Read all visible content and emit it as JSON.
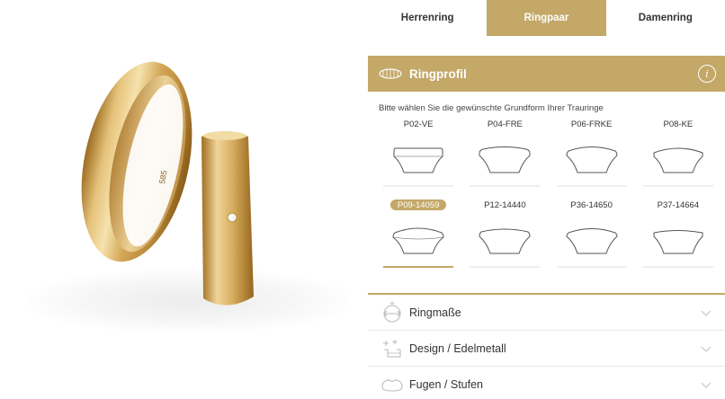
{
  "tabs": [
    {
      "label": "Herrenring",
      "active": false
    },
    {
      "label": "Ringpaar",
      "active": true
    },
    {
      "label": "Damenring",
      "active": false
    }
  ],
  "section": {
    "title": "Ringprofil",
    "info_icon": "info-icon",
    "instruction": "Bitte wählen Sie die gewünschte Grundform Ihrer Trauringe"
  },
  "profiles": [
    {
      "code": "P02-VE"
    },
    {
      "code": "P04-FRE"
    },
    {
      "code": "P06-FRKE"
    },
    {
      "code": "P08-KE"
    },
    {
      "code": "P09-14059",
      "selected": true
    },
    {
      "code": "P12-14440"
    },
    {
      "code": "P36-14650"
    },
    {
      "code": "P37-14664"
    }
  ],
  "product_image": {
    "engraving": "585"
  },
  "accordion": [
    {
      "label": "Ringmaße",
      "icon": "ruler-arrows-icon"
    },
    {
      "label": "Design / Edelmetall",
      "icon": "sparkle-icon"
    },
    {
      "label": "Fugen / Stufen",
      "icon": "groove-icon"
    }
  ],
  "colors": {
    "gold": "#c3a868",
    "text": "#333333"
  }
}
